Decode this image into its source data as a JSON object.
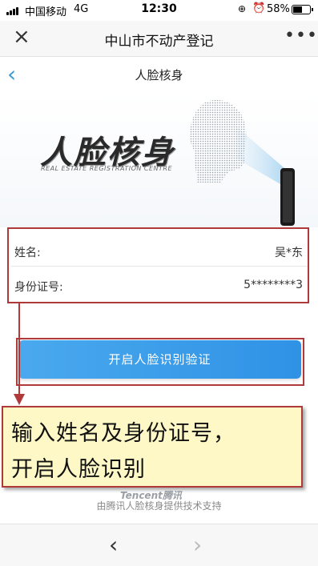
{
  "status_bar": {
    "carrier": "中国移动",
    "network": "4G",
    "time": "12:30",
    "battery_percent": "58%",
    "battery_level": 0.58,
    "icons": [
      "signal-icon",
      "orientation-lock-icon",
      "alarm-icon",
      "battery-icon"
    ]
  },
  "title_bar": {
    "title": "中山市不动产登记",
    "close_icon": "×",
    "more_icon": "•••"
  },
  "sub_header": {
    "back_icon": "‹",
    "title": "人脸核身"
  },
  "banner": {
    "heading": "人脸核身",
    "subheading": "REAL ESTATE REGISTRATION CENTRE"
  },
  "form": {
    "name_label": "姓名:",
    "name_value": "吴*东",
    "id_label": "身份证号:",
    "id_value": "5********3"
  },
  "button": {
    "label": "开启人脸识别验证"
  },
  "annotation": {
    "line1": "输入姓名及身份证号，",
    "line2": "开启人脸识别"
  },
  "footer": {
    "brand": "Tencent腾讯",
    "powered_by": "由腾讯人脸核身提供技术支持"
  },
  "bottom_nav": {
    "back_icon": "‹",
    "forward_icon": "›"
  },
  "colors": {
    "accent": "#3a9bd5",
    "button": "#3b9ceb",
    "annotation_border": "#b03a3a",
    "annotation_bg": "#fdf8c6"
  }
}
